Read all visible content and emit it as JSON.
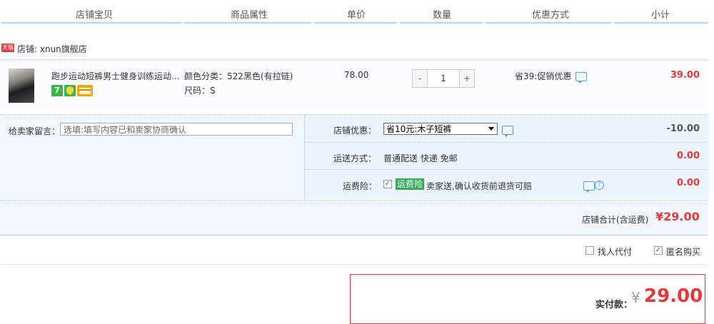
{
  "columns": [
    "店铺宝贝",
    "商品属性",
    "单价",
    "数量",
    "优惠方式",
    "小计"
  ],
  "shop": {
    "badge": "天猫",
    "label": "店铺: xnun旗舰店"
  },
  "item": {
    "title": "跑步运动短裤男士健身训练运动...",
    "badges": [
      "7",
      "盾",
      "卡"
    ],
    "attr_color": "颜色分类：522黑色(有拉链)",
    "attr_size": "尺码：S",
    "price": "78.00",
    "qty_minus": "-",
    "quantity": "1",
    "qty_plus": "+",
    "promo": "省39:促销优惠",
    "subtotal": "39.00"
  },
  "message": {
    "label": "给卖家留言：",
    "placeholder": "选填:填写内容已和卖家协商确认"
  },
  "discount": {
    "label": "店铺优惠：",
    "selected": "省10元:木子短裤",
    "amount": "-10.00"
  },
  "shipping": {
    "label": "运送方式：",
    "value": "普通配送 快递 免邮",
    "amount": "0.00"
  },
  "insurance": {
    "label": "运费险：",
    "tag": "运费险",
    "desc": "卖家送,确认收货前退货可赔",
    "amount": "0.00"
  },
  "shop_total": {
    "label": "店铺合计(含运费)",
    "amount": "¥29.00"
  },
  "extras": {
    "proxy_pay": "找人代付",
    "anonymous": "匿名购买"
  },
  "payment": {
    "label": "实付款：",
    "currency": "¥",
    "amount": "29.00"
  },
  "colors": {
    "accent_red": "#e4393c",
    "border_blue": "#b2d1ff",
    "row_bg": "#f2f7ff"
  }
}
